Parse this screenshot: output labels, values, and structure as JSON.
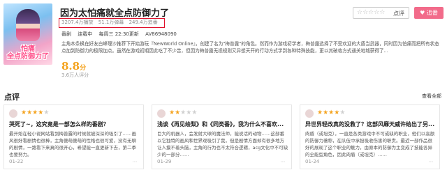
{
  "anime": {
    "title": "因为太怕痛就全点防御力了",
    "stats": [
      "3207.4万播放",
      "51.1万弹幕",
      "249.4万追番"
    ],
    "meta": [
      "番剧",
      "连载中",
      "每周三 22:30更新",
      "AV86948090"
    ],
    "description": "主角本条枫在好友白峰理沙推荐下开始游玩『NewWorld Online』，创建了名为\"梅普露\"的角色。然而作为游戏初学者，梅普露选择了不受欢迎的大盾当武器，同时因为怕痛而把所有状态点加到防御力的极限加点。虽然在游戏初期因此吃了不少苦，但因为梅普露无视规则又异想天开的行动方式学到各种特殊技能，更以其破格方式通关地城获得了...",
    "rating": "8.8",
    "rating_suffix": "分",
    "rating_count": "3.6万人评分",
    "poster_logo": "怕痛\n全点防御力了"
  },
  "actions": {
    "rate_stars": "☆☆☆☆☆",
    "rate_label": "点评",
    "follow_label": "追番"
  },
  "reviews_section": {
    "title": "点评",
    "see_all": "查看全部"
  },
  "reviews": [
    {
      "stars_on": 4,
      "title": "哭死了~，这究竟是一部怎么样的番剧？",
      "body": "最开始在轻小说网站看到梅普露的时候就被深深的吸引了……画风很好看剧情也很棒，主角傻萌傻萌的性格也很可爱，没有无聊的剧情，一路看下来真的很开心，希望能一直更新下去，第二季也要努力。",
      "date": "01-22"
    },
    {
      "stars_on": 2,
      "title": "浅谈《再见绘梨》和《同类番》，我为什么不喜欢...",
      "body": "巨大的机器人，会发射大球的魔法师，能说话的动物……这部番以它独特的画风和世界观吸引了我，但是剧情方面却有很多地方让人摸不着头脑，主角的行为也不太符合逻辑，acg文化中不可缺少的一部分……",
      "date": "01-29"
    },
    {
      "stars_on": 4,
      "title": "异世界轻改真的没救了？这部风靡天威许给出了另...",
      "body": "肉盾（或坦克），一直是各类游戏中不可或缺的职业，他们以高额的防御力著称，在队伍中承担吸收伤害的职责。最近一部作品很好的展现了这个职业的魅力，由原本的防御为主变成了技能各异的全能型角色，因此肉盾（或坦克）……",
      "date": "01-24"
    }
  ],
  "colors": {
    "accent_pink": "#f26b8a",
    "star_gold": "#f4a21c",
    "highlight_red": "#e0102c"
  }
}
